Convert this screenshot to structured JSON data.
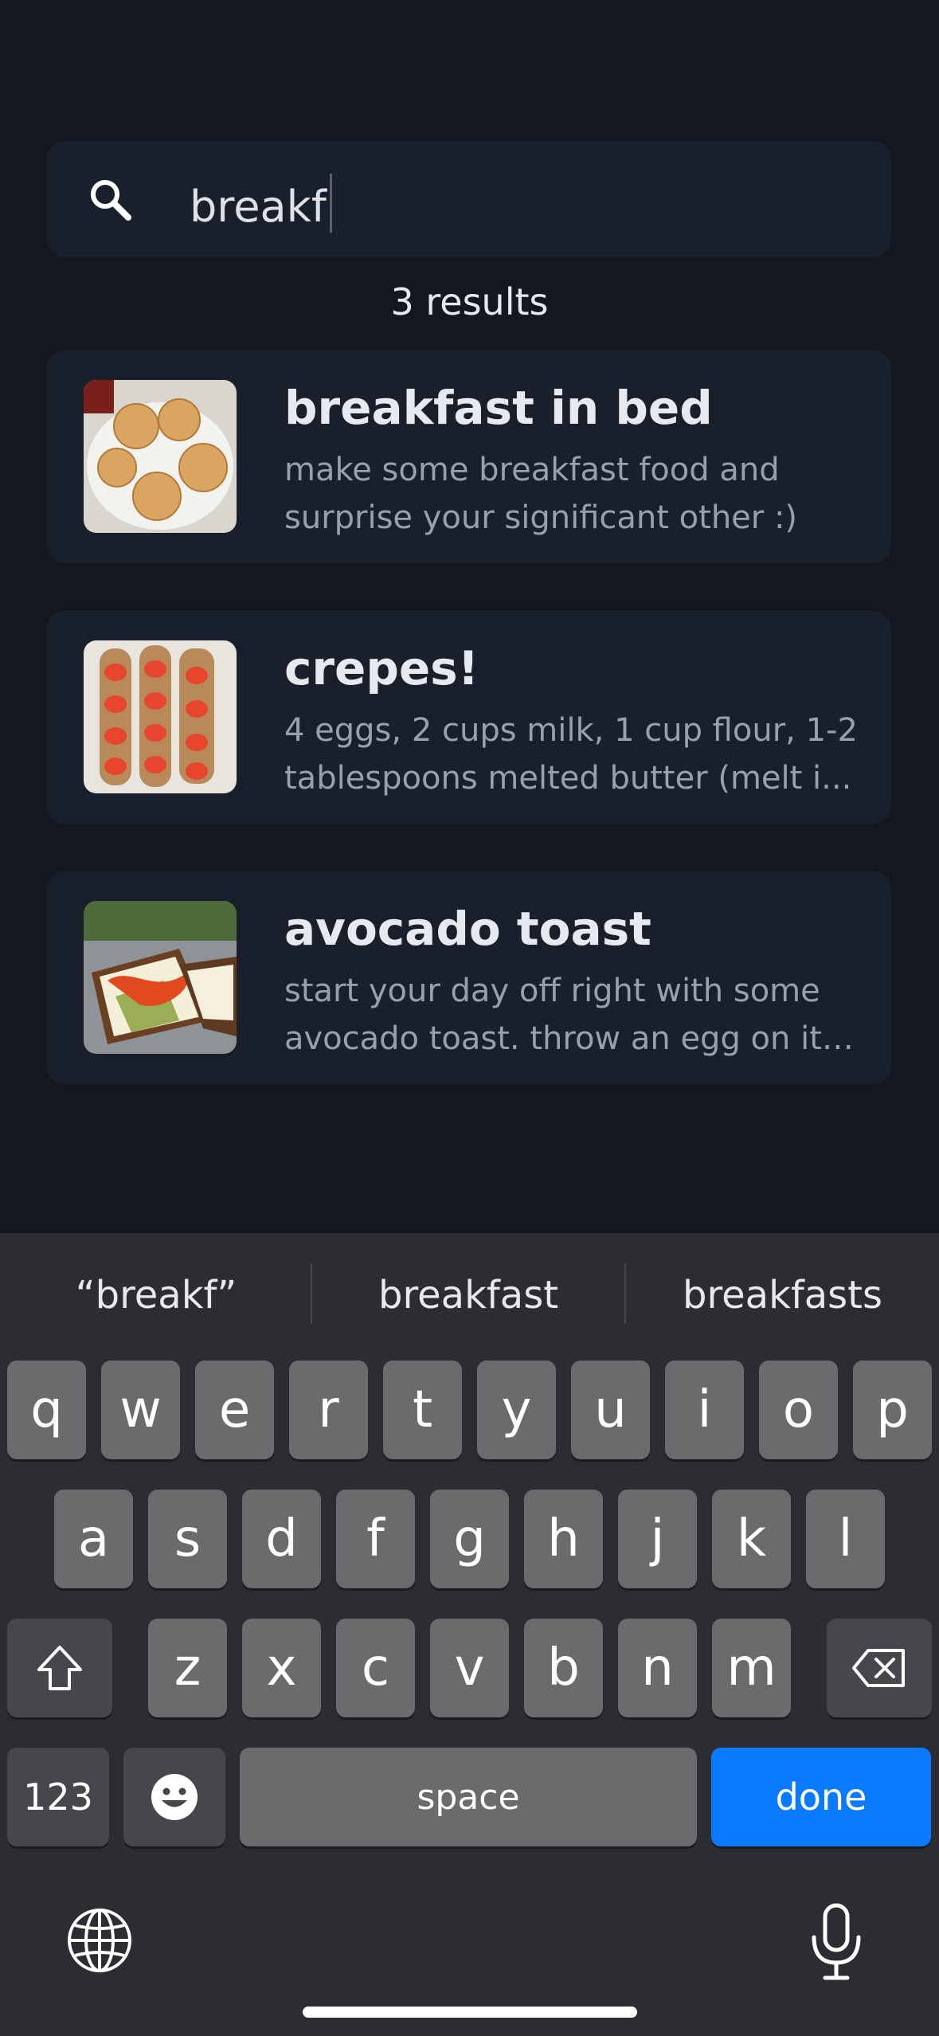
{
  "search": {
    "query": "breakf",
    "icon": "search-icon"
  },
  "results_count": "3 results",
  "results": [
    {
      "title": "breakfast in bed",
      "description": "make some breakfast food and surprise your significant other :)"
    },
    {
      "title": "crepes!",
      "description": "4 eggs, 2 cups milk, 1 cup flour, 1-2 tablespoons melted butter (melt i..."
    },
    {
      "title": "avocado toast",
      "description": "start your day off right with some avocado toast. throw an egg on it ..."
    }
  ],
  "keyboard": {
    "suggestions": [
      "“breakf”",
      "breakfast",
      "breakfasts"
    ],
    "row1": [
      "q",
      "w",
      "e",
      "r",
      "t",
      "y",
      "u",
      "i",
      "o",
      "p"
    ],
    "row2": [
      "a",
      "s",
      "d",
      "f",
      "g",
      "h",
      "j",
      "k",
      "l"
    ],
    "row3": [
      "z",
      "x",
      "c",
      "v",
      "b",
      "n",
      "m"
    ],
    "numbers_label": "123",
    "space_label": "space",
    "done_label": "done",
    "accent_color": "#0A7AFF"
  }
}
